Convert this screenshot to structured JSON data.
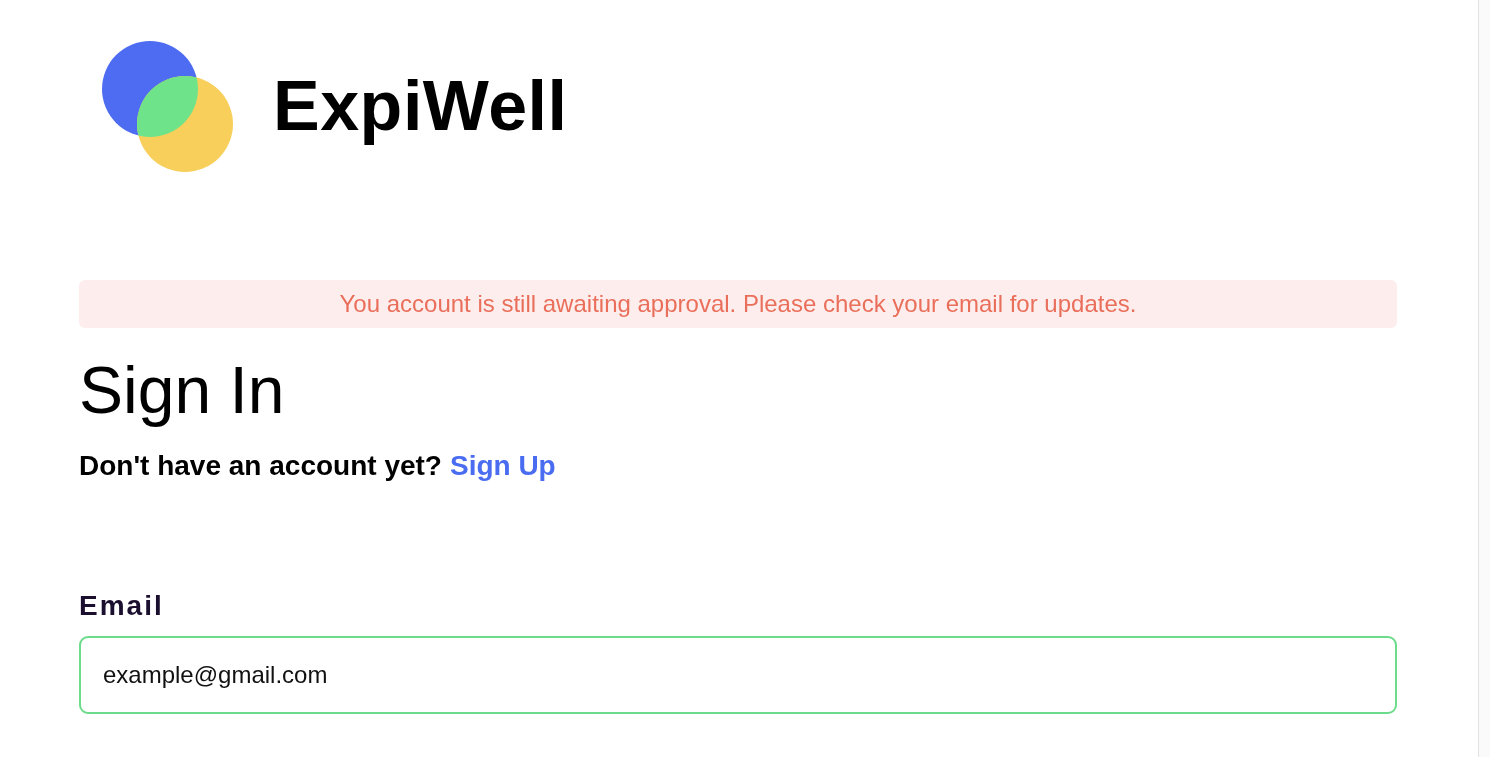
{
  "brand": {
    "name": "ExpiWell"
  },
  "alert": {
    "message": "You account is still awaiting approval. Please check your email for updates."
  },
  "heading": "Sign In",
  "signup_prompt": {
    "text": "Don't have an account yet?",
    "link": "Sign Up"
  },
  "email_field": {
    "label": "Email",
    "value": "example@gmail.com",
    "focused": true
  }
}
